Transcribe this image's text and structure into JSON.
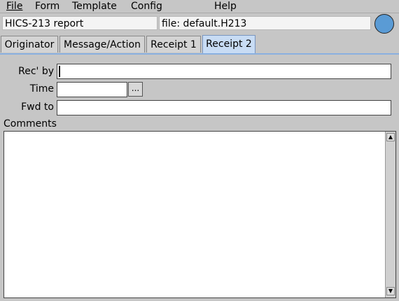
{
  "menu": {
    "file": "File",
    "form": "Form",
    "template": "Template",
    "config": "Config",
    "help": "Help"
  },
  "header": {
    "report_title": "HICS-213 report",
    "file_label": "file: default.H213",
    "status_color": "#5a9bd5"
  },
  "tabs": [
    "Originator",
    "Message/Action",
    "Receipt 1",
    "Receipt 2"
  ],
  "active_tab": "Receipt 2",
  "form": {
    "rec_by_label": "Rec' by",
    "rec_by_value": "",
    "time_label": "Time",
    "time_value": "",
    "time_button": "...",
    "fwd_to_label": "Fwd to",
    "fwd_to_value": "",
    "comments_label": "Comments",
    "comments_value": ""
  },
  "icons": {
    "scroll_up": "▲",
    "scroll_down": "▼"
  }
}
